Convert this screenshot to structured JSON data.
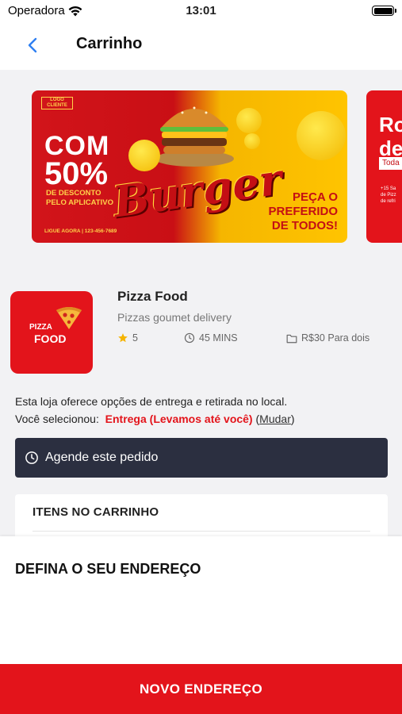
{
  "status_bar": {
    "carrier": "Operadora",
    "time": "13:01"
  },
  "nav": {
    "title": "Carrinho",
    "back_icon": "chevron-left-icon"
  },
  "banner_main": {
    "logo_text": "LOGO CLIENTE",
    "promo_line1": "COM",
    "promo_line2": "50%",
    "promo_sub1": "DE DESCONTO",
    "promo_sub2": "PELO APLICATIVO",
    "headline": "Burger",
    "cta_line1": "PEÇA O",
    "cta_line2": "PREFERIDO",
    "cta_line3": "DE TODOS!",
    "contact": "LIGUE AGORA | 123-456-7689"
  },
  "banner_next": {
    "line1": "Ro",
    "line2": "de",
    "chip": "Toda",
    "small1": "+15 Sa",
    "small2": "de Pizz",
    "small3": "de refri"
  },
  "store": {
    "logo_line1": "PIZZA",
    "logo_line2": "FOOD",
    "name": "Pizza Food",
    "description": "Pizzas goumet delivery",
    "rating": "5",
    "time": "45 MINS",
    "price": "R$30 Para dois"
  },
  "delivery": {
    "info": "Esta loja oferece opções de entrega e retirada no local.",
    "selected_label": "Você selecionou:",
    "selected_value": "Entrega (Levamos até você)",
    "change_label": "Mudar"
  },
  "schedule": {
    "label": "Agende este pedido"
  },
  "cart": {
    "title": "ITENS NO CARRINHO"
  },
  "address_sheet": {
    "title": "DEFINA O SEU ENDEREÇO",
    "button": "NOVO ENDEREÇO"
  },
  "colors": {
    "brand_red": "#e3141b",
    "dark_button": "#2b2f40",
    "star": "#f5b400"
  }
}
